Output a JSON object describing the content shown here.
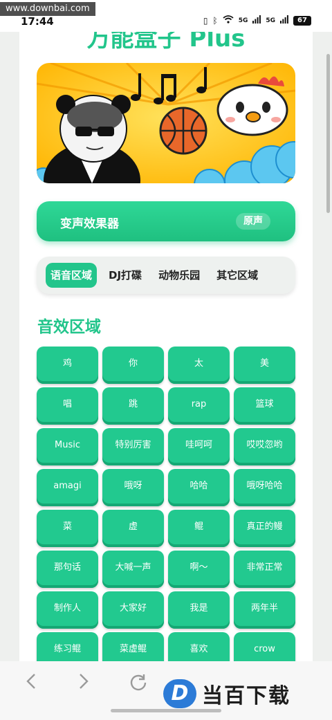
{
  "status_bar": {
    "watermark": "www.downbai.com",
    "time": "17:44",
    "signal_1": "5G",
    "signal_2": "5G",
    "battery": "67"
  },
  "page": {
    "title": "万能盒子 Plus"
  },
  "effect_bar": {
    "label": "变声效果器",
    "current_effect": "原声"
  },
  "tabs": [
    {
      "label": "语音区域",
      "active": true
    },
    {
      "label": "DJ打碟",
      "active": false
    },
    {
      "label": "动物乐园",
      "active": false
    },
    {
      "label": "其它区域",
      "active": false
    }
  ],
  "section": {
    "title": "音效区域"
  },
  "sound_buttons": [
    "鸡",
    "你",
    "太",
    "美",
    "唱",
    "跳",
    "rap",
    "篮球",
    "Music",
    "特别厉害",
    "哇呵呵",
    "哎哎忽哟",
    "amagi",
    "哦呀",
    "哈哈",
    "哦呀哈哈",
    "菜",
    "虚",
    "鲲",
    "真正的鳗",
    "那句话",
    "大喊一声",
    "啊～",
    "非常正常",
    "制作人",
    "大家好",
    "我是",
    "两年半",
    "练习鲲",
    "菜虚鲲",
    "喜欢",
    "crow"
  ],
  "bottom_nav": {
    "back_icon": "chevron-left-icon",
    "forward_icon": "chevron-right-icon",
    "refresh_icon": "refresh-icon",
    "logo_letter": "D",
    "logo_text": "当百下载"
  },
  "colors": {
    "accent": "#22c58b",
    "button": "#22c98f",
    "banner_yellow": "#ffc21a"
  }
}
